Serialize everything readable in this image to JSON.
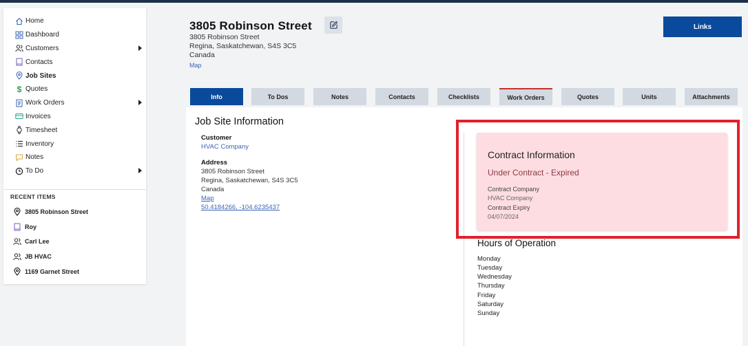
{
  "sidebar": {
    "items": [
      {
        "label": "Home",
        "icon": "home-icon"
      },
      {
        "label": "Dashboard",
        "icon": "dashboard-icon"
      },
      {
        "label": "Customers",
        "icon": "customers-icon"
      },
      {
        "label": "Contacts",
        "icon": "contacts-icon"
      },
      {
        "label": "Job Sites",
        "icon": "location-pin-icon"
      },
      {
        "label": "Quotes",
        "icon": "dollar-icon"
      },
      {
        "label": "Work Orders",
        "icon": "work-orders-icon"
      },
      {
        "label": "Invoices",
        "icon": "invoices-icon"
      },
      {
        "label": "Timesheet",
        "icon": "watch-icon"
      },
      {
        "label": "Inventory",
        "icon": "list-icon"
      },
      {
        "label": "Notes",
        "icon": "notes-icon"
      },
      {
        "label": "To Do",
        "icon": "clock-icon"
      }
    ]
  },
  "recent": {
    "title": "RECENT ITEMS",
    "items": [
      {
        "label": "3805 Robinson Street",
        "icon": "location-pin-icon"
      },
      {
        "label": "Roy",
        "icon": "contact-book-icon"
      },
      {
        "label": "Carl Lee",
        "icon": "person-icon"
      },
      {
        "label": "JB HVAC",
        "icon": "people-icon"
      },
      {
        "label": "1169 Garnet Street",
        "icon": "location-pin-icon"
      }
    ]
  },
  "header": {
    "title": "3805 Robinson Street",
    "address_line1": "3805 Robinson Street",
    "address_line2": "Regina, Saskatchewan, S4S 3C5",
    "address_line3": "Canada",
    "map_link": "Map",
    "links_button": "Links"
  },
  "tabs": [
    "Info",
    "To Dos",
    "Notes",
    "Contacts",
    "Checklists",
    "Work Orders",
    "Quotes",
    "Units",
    "Attachments"
  ],
  "job_site": {
    "title": "Job Site Information",
    "customer_label": "Customer",
    "customer_value": "HVAC Company",
    "address_label": "Address",
    "address_line1": "3805 Robinson Street",
    "address_line2": "Regina, Saskatchewan, S4S 3C5",
    "address_line3": "Canada",
    "map_link": "Map",
    "coordinates": "50.4184266, -104.6235437"
  },
  "contract": {
    "title": "Contract Information",
    "status": "Under Contract - Expired",
    "company_label": "Contract Company",
    "company_value": "HVAC Company",
    "expiry_label": "Contract Expiry",
    "expiry_value": "04/07/2024"
  },
  "hours": {
    "title": "Hours of Operation",
    "days": [
      "Monday",
      "Tuesday",
      "Wednesday",
      "Thursday",
      "Friday",
      "Saturday",
      "Sunday"
    ]
  },
  "colors": {
    "primary": "#0a4a9c",
    "link": "#3a64b5",
    "contract_bg": "#fddde1",
    "highlight": "#e0202d"
  }
}
